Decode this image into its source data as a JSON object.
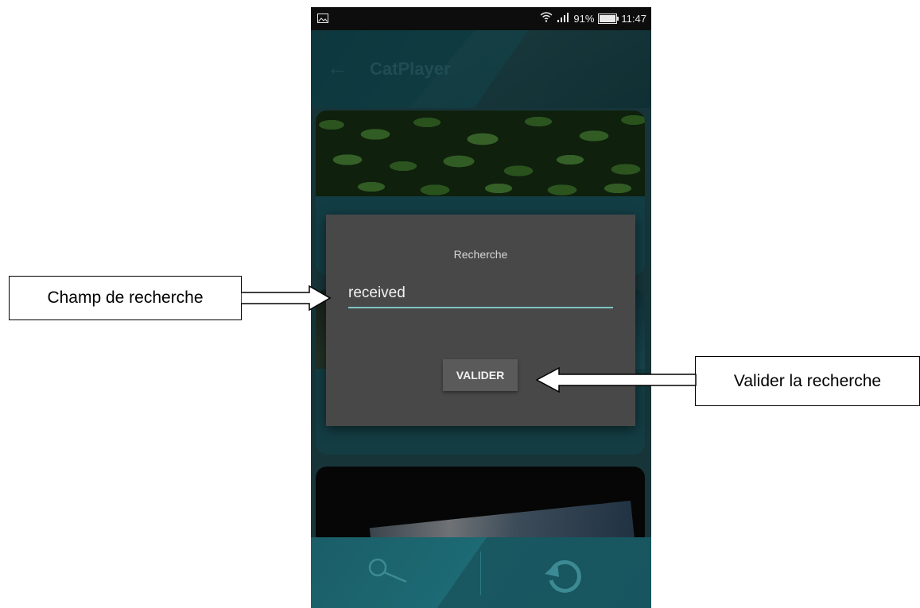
{
  "status_bar": {
    "wifi_icon": "wifi-icon",
    "signal_icon": "signal-icon",
    "battery_percent": "91%",
    "time": "11:47"
  },
  "app_bar": {
    "back_icon": "back-arrow-icon",
    "title": "CatPlayer"
  },
  "dialog": {
    "title": "Recherche",
    "search_value": "received",
    "submit_label": "VALIDER",
    "underline_color": "#7fc4c4"
  },
  "bottom_bar": {
    "search_icon": "search-icon",
    "refresh_icon": "refresh-icon"
  },
  "annotations": {
    "search_field_label": "Champ de recherche",
    "submit_label": "Valider la recherche"
  },
  "colors": {
    "accent": "#1c6d78",
    "dialog_bg": "#484848"
  }
}
